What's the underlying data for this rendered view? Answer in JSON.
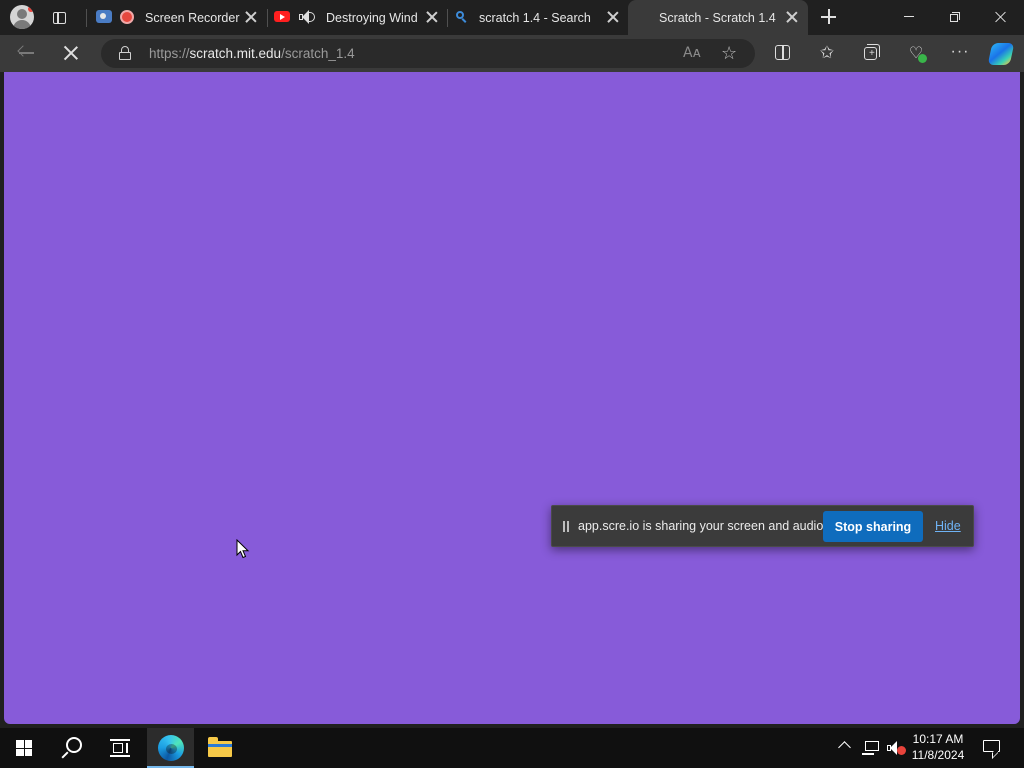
{
  "browser": {
    "tabs": [
      {
        "title": "Screen Recorder",
        "icon": "record-icon"
      },
      {
        "title": "Destroying Windo",
        "icon": "youtube-icon"
      },
      {
        "title": "scratch 1.4 - Search",
        "icon": "bing-search-icon"
      },
      {
        "title": "Scratch - Scratch 1.4",
        "icon": "none",
        "active": true
      }
    ],
    "address": {
      "protocol": "https://",
      "host": "scratch.mit.edu",
      "path": "/scratch_1.4"
    }
  },
  "page": {
    "background_color": "#875bd9"
  },
  "share_banner": {
    "message": "app.scre.io is sharing your screen and audio.",
    "stop_label": "Stop sharing",
    "hide_label": "Hide"
  },
  "taskbar": {
    "time": "10:17 AM",
    "date": "11/8/2024",
    "pinned": [
      "start-icon",
      "search-icon",
      "task-view-icon",
      "edge-icon",
      "file-explorer-icon"
    ]
  }
}
